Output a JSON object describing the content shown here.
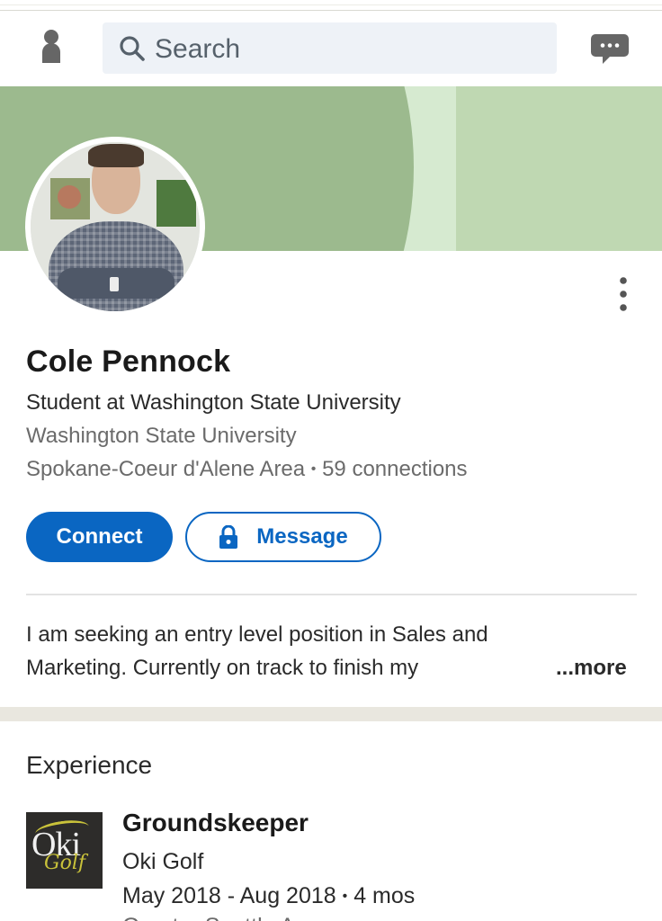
{
  "header": {
    "search_placeholder": "Search"
  },
  "profile": {
    "name": "Cole Pennock",
    "headline": "Student at Washington State University",
    "school": "Washington State University",
    "location": "Spokane-Coeur d'Alene Area",
    "separator": "•",
    "connections": "59 connections"
  },
  "actions": {
    "connect_label": "Connect",
    "message_label": "Message"
  },
  "about": {
    "text": "I am seeking an entry level position in Sales and Marketing. Currently on track to finish my",
    "more_label": "...more"
  },
  "experience": {
    "title": "Experience",
    "items": [
      {
        "title": "Groundskeeper",
        "company": "Oki Golf",
        "dates": "May 2018 - Aug 2018",
        "duration": "4 mos",
        "location": "Greater Seattle Area",
        "logo_text": "Oki",
        "logo_subtext": "Golf"
      }
    ]
  },
  "colors": {
    "accent": "#0a66c2",
    "banner_light": "#bfd8b2",
    "banner_dark": "#9cba8e",
    "logo_bg": "#2d2c2a",
    "logo_yellow": "#c9c23a"
  },
  "icons": {
    "me": "person-icon",
    "search": "search-icon",
    "messaging": "chat-bubble-icon",
    "overflow": "more-vertical-icon",
    "lock": "lock-icon"
  }
}
